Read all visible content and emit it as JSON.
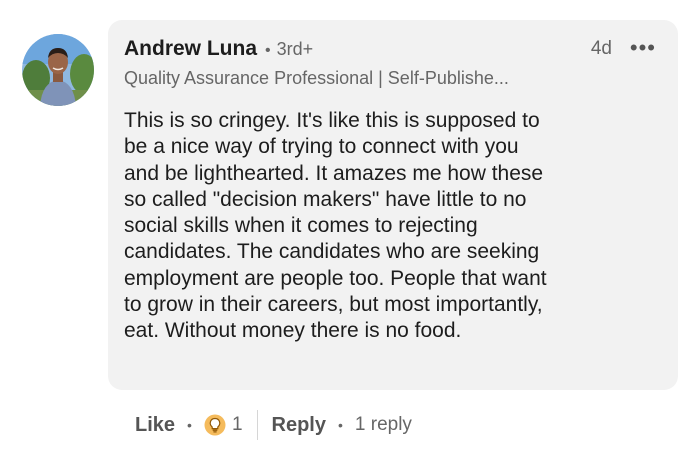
{
  "comment": {
    "author_name": "Andrew Luna",
    "connection_degree": "3rd+",
    "timestamp": "4d",
    "more_label": "•••",
    "headline": "Quality Assurance Professional | Self-Publishe...",
    "body_lines": [
      "This is so cringey. It's like this is supposed to",
      "be a nice way of trying to connect with you",
      "and be lighthearted. It amazes me how these",
      "so called \"decision makers\" have little to no",
      "social skills when it comes to rejecting",
      "candidates. The candidates who are seeking",
      "employment are people too. People that want",
      "to grow in their careers, but most importantly,",
      "eat. Without money there is no food."
    ]
  },
  "actions": {
    "like_label": "Like",
    "reaction_icon": "insightful-lightbulb-icon",
    "reaction_count": "1",
    "reply_label": "Reply",
    "replies_label": "1 reply"
  },
  "colors": {
    "bubble_background": "#f2f2f2",
    "reaction_icon": "#f5bb5c",
    "muted_text": "#666666"
  }
}
